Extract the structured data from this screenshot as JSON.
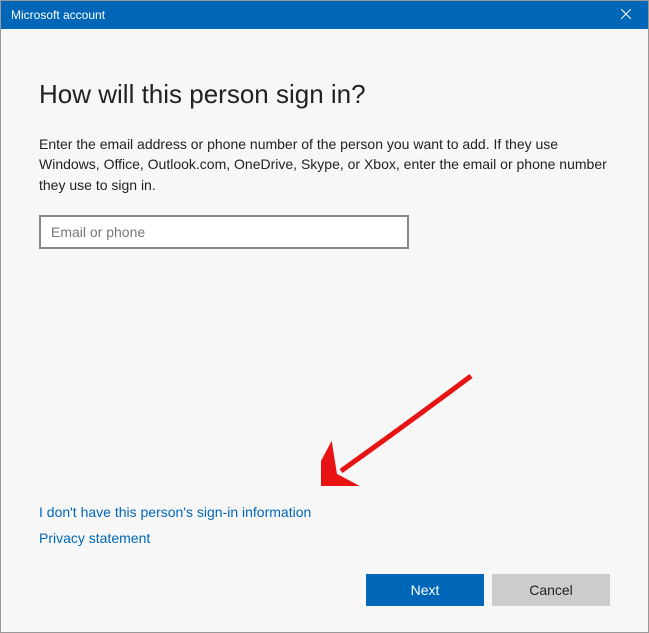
{
  "window": {
    "title": "Microsoft account"
  },
  "main": {
    "heading": "How will this person sign in?",
    "description": "Enter the email address or phone number of the person you want to add. If they use Windows, Office, Outlook.com, OneDrive, Skype, or Xbox, enter the email or phone number they use to sign in.",
    "input_placeholder": "Email or phone",
    "input_value": ""
  },
  "links": {
    "no_info": "I don't have this person's sign-in information",
    "privacy": "Privacy statement"
  },
  "buttons": {
    "next": "Next",
    "cancel": "Cancel"
  },
  "colors": {
    "accent": "#0067b8"
  }
}
